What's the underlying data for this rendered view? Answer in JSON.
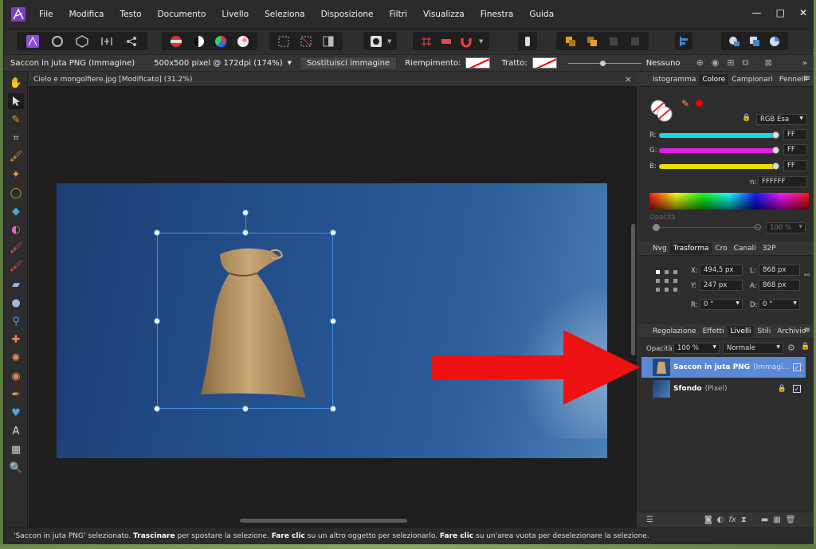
{
  "menu": [
    "File",
    "Modifica",
    "Testo",
    "Documento",
    "Livello",
    "Seleziona",
    "Disposizione",
    "Filtri",
    "Visualizza",
    "Finestra",
    "Guida"
  ],
  "window_controls": [
    "—",
    "□",
    "✕"
  ],
  "context": {
    "layer_name": "Saccon in juta PNG (Immagine)",
    "size": "500x500 pixel @ 172dpi (174%)",
    "replace_button": "Sostituisci immagine",
    "fill_label": "Riempimento:",
    "stroke_label": "Tratto:",
    "stroke_value": "Nessuno"
  },
  "document": {
    "tab_title": "Cielo e mongolfiere.jpg [Modificato] (31.2%)",
    "close": "×"
  },
  "panels": {
    "color_tabs": [
      "Istogramma",
      "Colore",
      "Campionari",
      "Pennelli"
    ],
    "color_active": "Colore",
    "color_model": "RGB Esa",
    "channels": [
      {
        "label": "R:",
        "value": "FF",
        "color": "#18d8e8"
      },
      {
        "label": "G:",
        "value": "FF",
        "color": "#e020e0"
      },
      {
        "label": "B:",
        "value": "FF",
        "color": "#f0e000"
      }
    ],
    "hex_label": "n:",
    "hex_value": "FFFFFF",
    "opacity_label": "Opacità",
    "opacity_value": "100 %",
    "transform_tabs": [
      "Nvg",
      "Trasforma",
      "Cro",
      "Canali",
      "32P"
    ],
    "transform_active": "Trasforma",
    "transform": {
      "x_label": "X:",
      "x": "494,5 px",
      "y_label": "Y:",
      "y": "247 px",
      "w_label": "L:",
      "w": "868 px",
      "h_label": "A:",
      "h": "868 px",
      "r_label": "R:",
      "r": "0 °",
      "s_label": "D:",
      "s": "0 °"
    },
    "layer_tabs": [
      "Regolazione",
      "Effetti",
      "Livelli",
      "Stili",
      "Archivio"
    ],
    "layer_active": "Livelli",
    "layer_opacity_label": "Opacità:",
    "layer_opacity": "100 %",
    "blend_mode": "Normale",
    "layers": [
      {
        "name": "Saccon in juta PNG",
        "type": "(Immagi...",
        "selected": true
      },
      {
        "name": "Sfondo",
        "type": "(Pixel)",
        "selected": false
      }
    ]
  },
  "status": {
    "p1": "'Saccon in juta PNG' selezionato.",
    "b1": "Trascinare",
    "p2": "per spostare la selezione.",
    "b2": "Fare clic",
    "p3": "su un altro oggetto per selezionarlo.",
    "b3": "Fare clic",
    "p4": "su un'area vuota per deselezionare la selezione."
  },
  "colors": {
    "accent": "#3d8fe0",
    "arrow": "#ee1111",
    "selected_layer": "#5a8ad6"
  }
}
